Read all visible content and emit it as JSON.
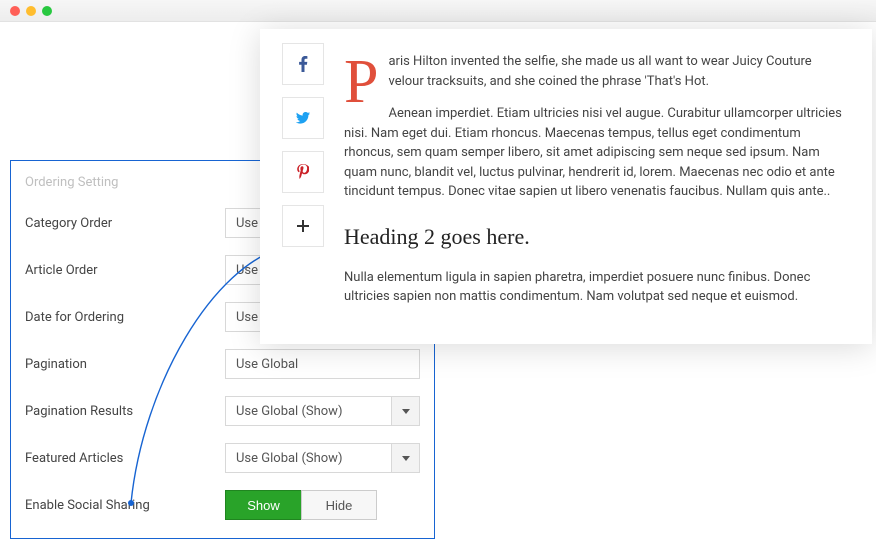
{
  "settings": {
    "title": "Ordering Setting",
    "fields": {
      "category_order": {
        "label": "Category Order",
        "value": "Use Global"
      },
      "article_order": {
        "label": "Article Order",
        "value": "Use Global"
      },
      "date_ordering": {
        "label": "Date for Ordering",
        "value": "Use Global"
      },
      "pagination": {
        "label": "Pagination",
        "value": "Use Global"
      },
      "pagination_results": {
        "label": "Pagination Results",
        "value": "Use Global (Show)"
      },
      "featured_articles": {
        "label": "Featured Articles",
        "value": "Use Global (Show)"
      },
      "social_sharing": {
        "label": "Enable Social Sharing",
        "show": "Show",
        "hide": "Hide",
        "active": "show"
      }
    }
  },
  "preview": {
    "dropcap": "P",
    "intro": "aris Hilton invented the selfie, she made us all want to wear Juicy Couture velour tracksuits, and she coined the phrase 'That's Hot.",
    "para": "Aenean imperdiet. Etiam ultricies nisi vel augue. Curabitur ullamcorper ultricies nisi. Nam eget dui. Etiam rhoncus. Maecenas tempus, tellus eget condimentum rhoncus, sem quam semper libero, sit amet adipiscing sem neque sed ipsum. Nam quam nunc, blandit vel, luctus pulvinar, hendrerit id, lorem. Maecenas nec odio et ante tincidunt tempus. Donec vitae sapien ut libero venenatis faucibus. Nullam quis ante..",
    "heading": "Heading 2 goes here.",
    "para2": "Nulla elementum ligula in sapien pharetra, imperdiet posuere nunc finibus. Donec ultricies sapien non mattis condimentum. Nam volutpat sed neque et euismod.",
    "social": {
      "facebook": "facebook-icon",
      "twitter": "twitter-icon",
      "pinterest": "pinterest-icon",
      "more": "plus-icon"
    }
  }
}
